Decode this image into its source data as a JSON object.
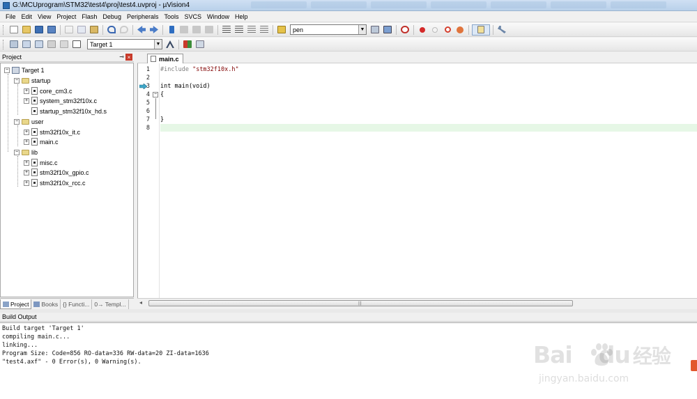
{
  "window": {
    "title": "G:\\MCUprogram\\STM32\\test4\\proj\\test4.uvproj - µVision4"
  },
  "menubar": {
    "items": [
      "File",
      "Edit",
      "View",
      "Project",
      "Flash",
      "Debug",
      "Peripherals",
      "Tools",
      "SVCS",
      "Window",
      "Help"
    ]
  },
  "toolbar": {
    "find_combo_value": "pen",
    "target_combo_value": "Target 1"
  },
  "project_panel": {
    "title": "Project",
    "tree": {
      "root": "Target 1",
      "groups": [
        {
          "name": "startup",
          "files": [
            "core_cm3.c",
            "system_stm32f10x.c",
            "startup_stm32f10x_hd.s"
          ]
        },
        {
          "name": "user",
          "files": [
            "stm32f10x_it.c",
            "main.c"
          ]
        },
        {
          "name": "lib",
          "files": [
            "misc.c",
            "stm32f10x_gpio.c",
            "stm32f10x_rcc.c"
          ]
        }
      ]
    },
    "tabs": [
      "Project",
      "Books",
      "{} Functi...",
      "0→ Templ..."
    ]
  },
  "editor": {
    "tab_label": "main.c",
    "lines": [
      {
        "num": "1",
        "text": "#include \"stm32f10x.h\""
      },
      {
        "num": "2",
        "text": ""
      },
      {
        "num": "3",
        "text": "int main(void)"
      },
      {
        "num": "4",
        "text": "{"
      },
      {
        "num": "5",
        "text": ""
      },
      {
        "num": "6",
        "text": ""
      },
      {
        "num": "7",
        "text": "}"
      },
      {
        "num": "8",
        "text": ""
      }
    ],
    "include_directive": "#include",
    "include_file": "\"stm32f10x.h\""
  },
  "build_output": {
    "title": "Build Output",
    "lines": [
      "Build target 'Target 1'",
      "compiling main.c...",
      "linking...",
      "Program Size: Code=856 RO-data=336 RW-data=20 ZI-data=1636",
      "\"test4.axf\" - 0 Error(s), 0 Warning(s)."
    ]
  },
  "watermark": {
    "brand": "Bai",
    "brand_suffix": "du",
    "cn": "经验",
    "url": "jingyan.baidu.com"
  },
  "colors": {
    "current_line_highlight": "#e6f7e6",
    "string_color": "#800000",
    "preprocessor_color": "#808080"
  }
}
